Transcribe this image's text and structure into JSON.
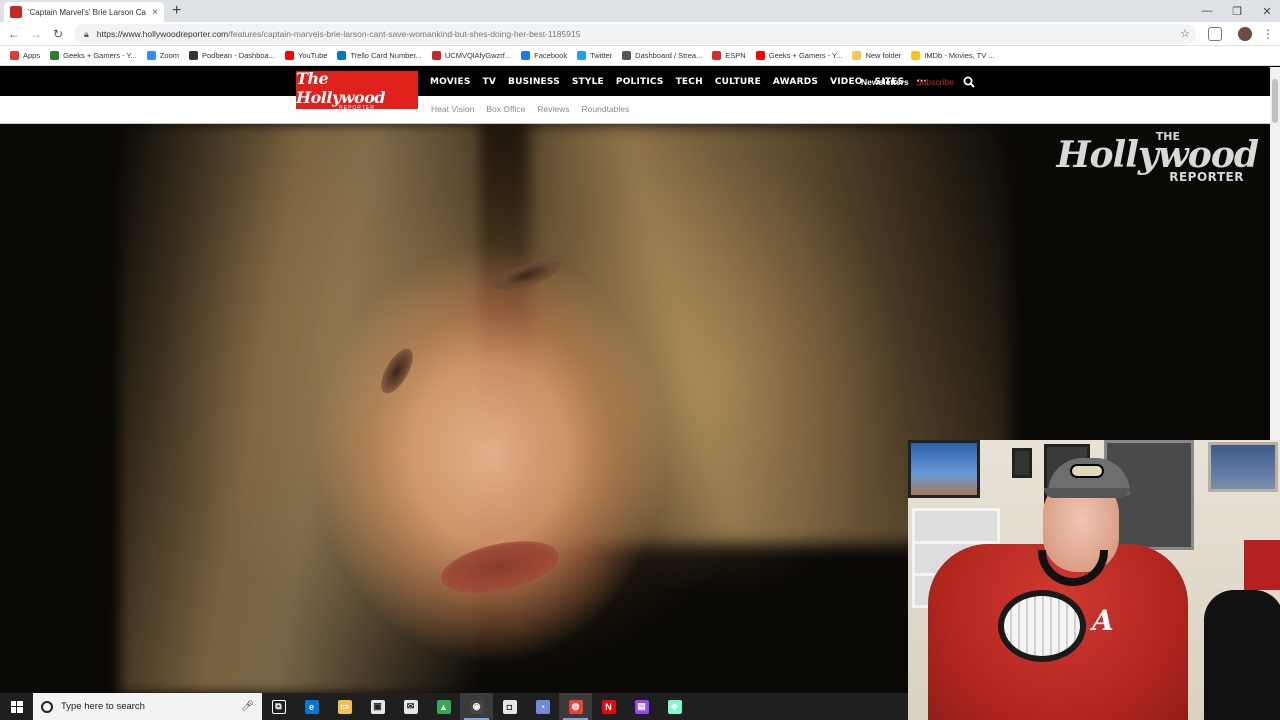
{
  "browser": {
    "tab_title": "'Captain Marvel's' Brie Larson Ca",
    "tab_close": "×",
    "new_tab": "+",
    "window_controls": [
      "—",
      "❐",
      "✕"
    ],
    "url_host": "https://www.hollywoodreporter.com",
    "url_path": "/features/captain-marvels-brie-larson-cant-save-womankind-but-shes-doing-her-best-1185915",
    "bookmarks": [
      {
        "label": "Apps",
        "color": "#e53935"
      },
      {
        "label": "Geeks + Gamers - Y...",
        "color": "#2e7d32"
      },
      {
        "label": "Zoom",
        "color": "#2d8cff"
      },
      {
        "label": "Podbean - Dashboa...",
        "color": "#333333"
      },
      {
        "label": "YouTube",
        "color": "#ff0000"
      },
      {
        "label": "Trello Card Number...",
        "color": "#0079bf"
      },
      {
        "label": "UCMVQlAfyGwzrf...",
        "color": "#c62828"
      },
      {
        "label": "Facebook",
        "color": "#1877f2"
      },
      {
        "label": "Twitter",
        "color": "#1da1f2"
      },
      {
        "label": "Dashboard / Strea...",
        "color": "#555555"
      },
      {
        "label": "ESPN",
        "color": "#d32f2f"
      },
      {
        "label": "Geeks + Gamers - Y...",
        "color": "#ff0000"
      },
      {
        "label": "New folder",
        "color": "#f9c74f"
      },
      {
        "label": "IMDb - Movies, TV ...",
        "color": "#f5c518"
      }
    ]
  },
  "site": {
    "logo": "The Hollywood",
    "logo_sub": "REPORTER",
    "nav": [
      "MOVIES",
      "TV",
      "BUSINESS",
      "STYLE",
      "POLITICS",
      "TECH",
      "CULTURE",
      "AWARDS",
      "VIDEO",
      "SITES",
      "···"
    ],
    "newsletters": "Newsletters",
    "subscribe": "Subscribe",
    "subnav": [
      "Heat Vision",
      "Box Office",
      "Reviews",
      "Roundtables"
    ],
    "watermark_the": "THE",
    "watermark_main": "Hollywood",
    "watermark_sub": "REPORTER"
  },
  "webcam": {
    "shirt_letter": "A"
  },
  "taskbar": {
    "search_placeholder": "Type here to search",
    "apps": [
      {
        "name": "task-view",
        "color": "#1f1f1f",
        "glyph": "⧉",
        "active": false
      },
      {
        "name": "edge",
        "color": "#0078d7",
        "glyph": "e",
        "active": false
      },
      {
        "name": "file-explorer",
        "color": "#f2c14e",
        "glyph": "▭",
        "active": false
      },
      {
        "name": "store",
        "color": "#e6e6e6",
        "glyph": "▣",
        "active": false
      },
      {
        "name": "mail",
        "color": "#e6e6e6",
        "glyph": "✉",
        "active": false
      },
      {
        "name": "google-drive",
        "color": "#34a853",
        "glyph": "▲",
        "active": false
      },
      {
        "name": "obs",
        "color": "#444444",
        "glyph": "◉",
        "active": true
      },
      {
        "name": "camera",
        "color": "#e6e6e6",
        "glyph": "◘",
        "active": false
      },
      {
        "name": "discord",
        "color": "#7289da",
        "glyph": "◔",
        "active": false
      },
      {
        "name": "chrome",
        "color": "#ea4335",
        "glyph": "◍",
        "active": true
      },
      {
        "name": "netflix",
        "color": "#e50914",
        "glyph": "N",
        "active": false
      },
      {
        "name": "twitch",
        "color": "#9146ff",
        "glyph": "▤",
        "active": false
      },
      {
        "name": "streamlabs",
        "color": "#80f5d2",
        "glyph": "◈",
        "active": false
      }
    ]
  }
}
